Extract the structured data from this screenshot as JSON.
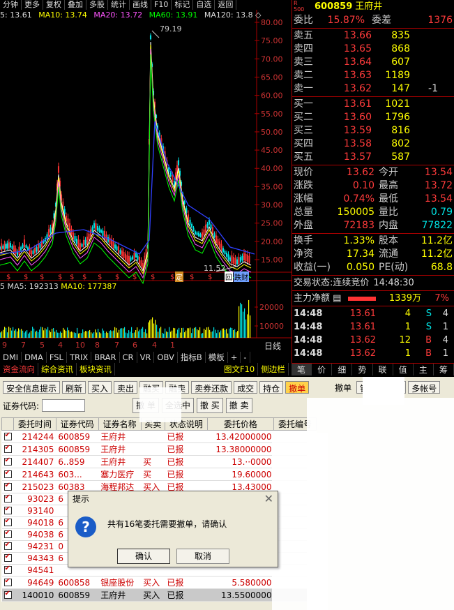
{
  "toolbar": {
    "items": [
      "分钟",
      "更多",
      "复权",
      "叠加",
      "多股",
      "统计",
      "画线",
      "F10",
      "标记",
      "自选",
      "返回"
    ]
  },
  "ma_legend": {
    "ma5": "5: 13.61",
    "ma10": "MA10: 13.74",
    "ma20": "MA20: 13.72",
    "ma60": "MA60: 13.91",
    "ma120": "MA120: 13.8 ◇"
  },
  "price_axis": [
    "80.00",
    "75.00",
    "70.00",
    "65.00",
    "60.00",
    "55.00",
    "50.00",
    "45.00",
    "40.00",
    "35.00",
    "30.00",
    "25.00",
    "20.00",
    "15.00"
  ],
  "chart_annotations": {
    "high": "79.19",
    "low": "11.52",
    "badge1": "定",
    "badge2": "回",
    "badge3": "跌财"
  },
  "vol_legend": {
    "label": "5  MA5: 192313",
    "ma10": "MA10: 177387"
  },
  "vol_axis": [
    "20000",
    "10000"
  ],
  "date_axis": [
    "9",
    "7",
    "5",
    "4",
    "10",
    "8",
    "7",
    "6",
    "4",
    "1"
  ],
  "date_label": "日线",
  "indicator_tabs": [
    "DMI",
    "DMA",
    "FSL",
    "TRIX",
    "BRAR",
    "CR",
    "VR",
    "OBV",
    "指标B",
    "模板",
    "+",
    "-"
  ],
  "bottom_tabs": [
    "资金流向",
    "综合资讯",
    "板块资讯",
    "图文F10",
    "侧边栏"
  ],
  "quote": {
    "rlabel": "R",
    "code": "600859",
    "name": "王府井",
    "rank": "500",
    "webi_label": "委比",
    "webi": "15.87%",
    "weicha_label": "委差",
    "weicha": "1376",
    "sell": [
      {
        "label": "卖五",
        "price": "13.66",
        "vol": "835",
        "chg": ""
      },
      {
        "label": "卖四",
        "price": "13.65",
        "vol": "868",
        "chg": ""
      },
      {
        "label": "卖三",
        "price": "13.64",
        "vol": "607",
        "chg": ""
      },
      {
        "label": "卖二",
        "price": "13.63",
        "vol": "1189",
        "chg": ""
      },
      {
        "label": "卖一",
        "price": "13.62",
        "vol": "147",
        "chg": "-1"
      }
    ],
    "buy": [
      {
        "label": "买一",
        "price": "13.61",
        "vol": "1021"
      },
      {
        "label": "买二",
        "price": "13.60",
        "vol": "1796"
      },
      {
        "label": "买三",
        "price": "13.59",
        "vol": "816"
      },
      {
        "label": "买四",
        "price": "13.58",
        "vol": "802"
      },
      {
        "label": "买五",
        "price": "13.57",
        "vol": "587"
      }
    ],
    "stats": [
      {
        "l1": "现价",
        "v1": "13.62",
        "l2": "今开",
        "v2": "13.54"
      },
      {
        "l1": "涨跌",
        "v1": "0.10",
        "l2": "最高",
        "v2": "13.72"
      },
      {
        "l1": "涨幅",
        "v1": "0.74%",
        "l2": "最低",
        "v2": "13.54"
      },
      {
        "l1": "总量",
        "v1": "150005",
        "l2": "量比",
        "v2": "0.79"
      },
      {
        "l1": "外盘",
        "v1": "72183",
        "l2": "内盘",
        "v2": "77822"
      }
    ],
    "stats2": [
      {
        "l1": "换手",
        "v1": "1.33%",
        "l2": "股本",
        "v2": "11.2亿"
      },
      {
        "l1": "净资",
        "v1": "17.34",
        "l2": "流通",
        "v2": "11.2亿"
      },
      {
        "l1": "收益(一)",
        "v1": "0.050",
        "l2": "PE(动)",
        "v2": "68.8"
      }
    ],
    "status_label": "交易状态:",
    "status": "连续竞价",
    "status_time": "14:48:30",
    "mainflow_label": "主力净额",
    "mainflow": "1339万",
    "mainflow_pct": "7%",
    "ticks": [
      {
        "t": "14:48",
        "p": "13.61",
        "v": "4",
        "s": "S",
        "x": "4"
      },
      {
        "t": "14:48",
        "p": "13.61",
        "v": "1",
        "s": "S",
        "x": "1"
      },
      {
        "t": "14:48",
        "p": "13.62",
        "v": "12",
        "s": "B",
        "x": "4"
      },
      {
        "t": "14:48",
        "p": "13.62",
        "v": "1",
        "s": "B",
        "x": "1"
      }
    ],
    "rtabs": [
      "笔",
      "价",
      "细",
      "势",
      "联",
      "值",
      "主",
      "筹"
    ]
  },
  "trade": {
    "buttons": [
      "安全信息提示",
      "刷新",
      "买入",
      "卖出",
      "融买",
      "融卖",
      "卖券还款",
      "成交",
      "持仓",
      "撤单",
      "撤单",
      "锁定",
      "系统",
      "多帐号"
    ],
    "code_label": "证券代码:",
    "action_buttons": [
      "撤 单",
      "全选中",
      "撤 买",
      "撤 卖"
    ],
    "columns": [
      "委托时间",
      "证券代码",
      "证券名称",
      "买卖",
      "状态说明",
      "委托价格",
      "委托编号"
    ],
    "rows": [
      {
        "time": "214244",
        "code": "600859",
        "name": "王府井",
        "side": "",
        "status": "已报",
        "price": "13.42000000"
      },
      {
        "time": "214305",
        "code": "600859",
        "name": "王府井",
        "side": "",
        "status": "已报",
        "price": "13.38000000"
      },
      {
        "time": "214407",
        "code": "6..859",
        "name": "王府井",
        "side": "买",
        "status": "已报",
        "price": "13.··0000"
      },
      {
        "time": "214643",
        "code": "603...",
        "name": "塞力医疗",
        "side": "买",
        "status": "已报",
        "price": "19.60000"
      },
      {
        "time": "215023",
        "code": "60383",
        "name": "海程邦达",
        "side": "买入",
        "status": "已报",
        "price": "13.43000"
      },
      {
        "time": "93023",
        "code": "6",
        "name": "",
        "side": "",
        "status": "",
        "price": ""
      },
      {
        "time": "93140",
        "code": "",
        "name": "",
        "side": "",
        "status": "",
        "price": ""
      },
      {
        "time": "94018",
        "code": "6",
        "name": "",
        "side": "",
        "status": "",
        "price": ""
      },
      {
        "time": "94038",
        "code": "6",
        "name": "",
        "side": "",
        "status": "",
        "price": ""
      },
      {
        "time": "94231",
        "code": "0",
        "name": "",
        "side": "",
        "status": "",
        "price": ""
      },
      {
        "time": "94343",
        "code": "6",
        "name": "",
        "side": "",
        "status": "",
        "price": ""
      },
      {
        "time": "94541",
        "code": "",
        "name": "",
        "side": "",
        "status": "",
        "price": ""
      },
      {
        "time": "94649",
        "code": "600858",
        "name": "银座股份",
        "side": "买入",
        "status": "已报",
        "price": "5.580000"
      },
      {
        "time": "140010",
        "code": "600859",
        "name": "王府井",
        "side": "买入",
        "status": "已报",
        "price": "13.5500000"
      }
    ]
  },
  "dialog": {
    "title": "提示",
    "message": "共有16笔委托需要撤单，请确认",
    "ok": "确认",
    "cancel": "取消",
    "icon": "?"
  }
}
